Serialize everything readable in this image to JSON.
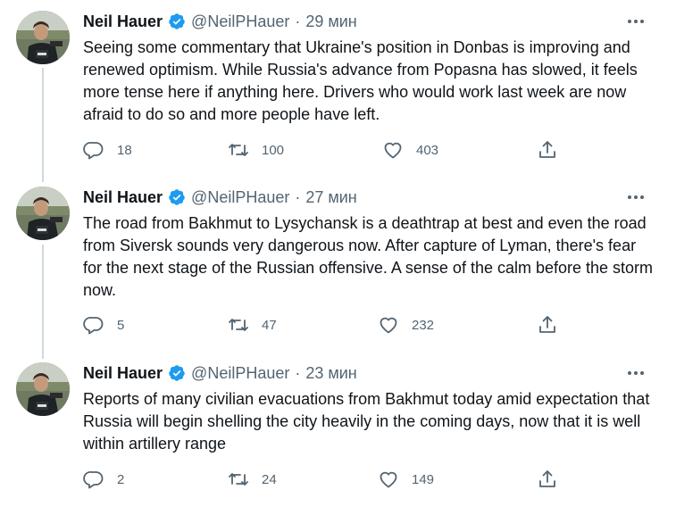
{
  "tweets": [
    {
      "author_name": "Neil Hauer",
      "handle": "@NeilPHauer",
      "separator": "·",
      "time": "29 мин",
      "text": "Seeing some commentary that Ukraine's position in Donbas is improving and renewed optimism. While Russia's advance from Popasna has slowed, it feels more tense here if anything here. Drivers who would work last week are now afraid to do so and more people have left.",
      "replies": "18",
      "retweets": "100",
      "likes": "403"
    },
    {
      "author_name": "Neil Hauer",
      "handle": "@NeilPHauer",
      "separator": "·",
      "time": "27 мин",
      "text": "The road from Bakhmut to Lysychansk is a deathtrap at best and even the road from Siversk sounds very dangerous now. After capture of Lyman, there's fear for the next stage of the Russian offensive. A sense of the calm before the storm now.",
      "replies": "5",
      "retweets": "47",
      "likes": "232"
    },
    {
      "author_name": "Neil Hauer",
      "handle": "@NeilPHauer",
      "separator": "·",
      "time": "23 мин",
      "text": "Reports of many civilian evacuations from Bakhmut today amid expectation that Russia will begin shelling the city heavily in the coming days, now that it is well within artillery range",
      "replies": "2",
      "retweets": "24",
      "likes": "149"
    }
  ],
  "icons": {
    "verified": "verified-badge-icon",
    "more": "more-dots-icon",
    "reply": "reply-icon",
    "retweet": "retweet-icon",
    "like": "heart-icon",
    "share": "share-icon"
  },
  "colors": {
    "text": "#0f1419",
    "secondary": "#536471",
    "verified": "#1d9bf0",
    "thread_line": "#cfd9de"
  }
}
